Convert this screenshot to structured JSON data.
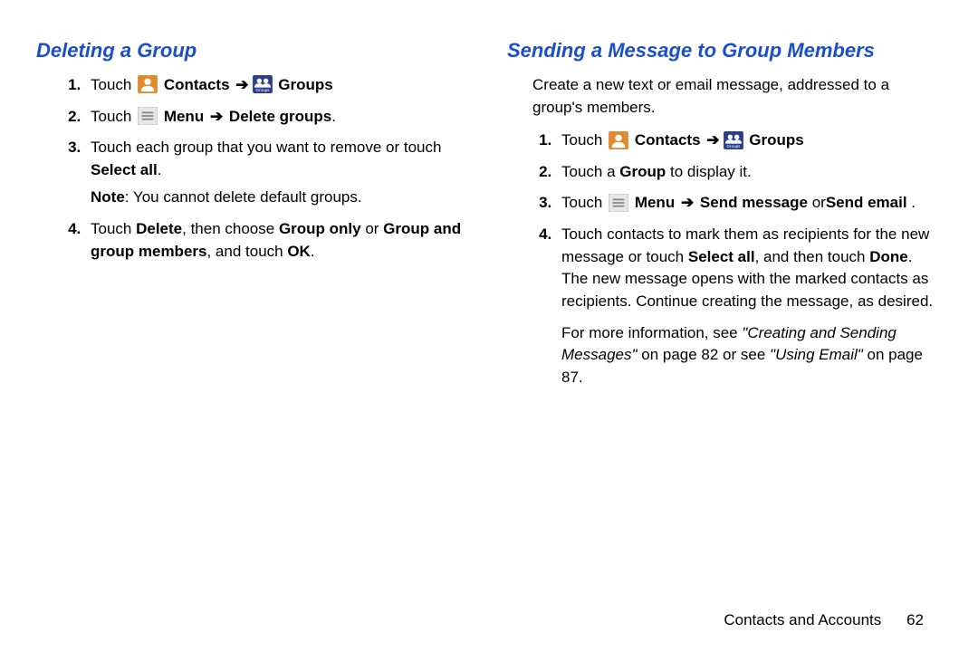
{
  "left": {
    "heading": "Deleting a Group",
    "step1_a": "Touch ",
    "step1_b": " Contacts ",
    "step1_c": " Groups",
    "step2_a": "Touch ",
    "step2_b": " Menu ",
    "step2_c": " Delete groups",
    "step3_a": "Touch each group that you want to remove or touch ",
    "step3_b": "Select all",
    "step3_note_a": "Note",
    "step3_note_b": ": You cannot delete default groups.",
    "step4_a": "Touch ",
    "step4_b": "Delete",
    "step4_c": ", then choose ",
    "step4_d": "Group only",
    "step4_e": " or ",
    "step4_f": "Group and group members",
    "step4_g": ", and touch ",
    "step4_h": "OK",
    "step4_i": "."
  },
  "right": {
    "heading": "Sending a Message to Group Members",
    "intro": "Create a new text or email message, addressed to a group's members.",
    "step1_a": "Touch ",
    "step1_b": " Contacts ",
    "step1_c": " Groups",
    "step2_a": "Touch a ",
    "step2_b": "Group",
    "step2_c": " to display it.",
    "step3_a": "Touch ",
    "step3_b": " Menu ",
    "step3_c": " Send message",
    "step3_d": " or",
    "step3_e": "Send email",
    "step3_f": " .",
    "step4_a": "Touch contacts to mark them as recipients for the new message or touch ",
    "step4_b": "Select all",
    "step4_c": ", and then touch ",
    "step4_d": "Done",
    "step4_e": ".",
    "follow1_a": "The new message opens with the marked contacts as recipients. Continue creating the message, as desired.",
    "follow2_a": "For more information, see ",
    "follow2_b": "\"Creating and Sending Messages\"",
    "follow2_c": " on page 82 or see ",
    "follow2_d": "\"Using Email\"",
    "follow2_e": " on page 87."
  },
  "footer": {
    "section": "Contacts and Accounts",
    "page": "62"
  },
  "arrow": "➔"
}
